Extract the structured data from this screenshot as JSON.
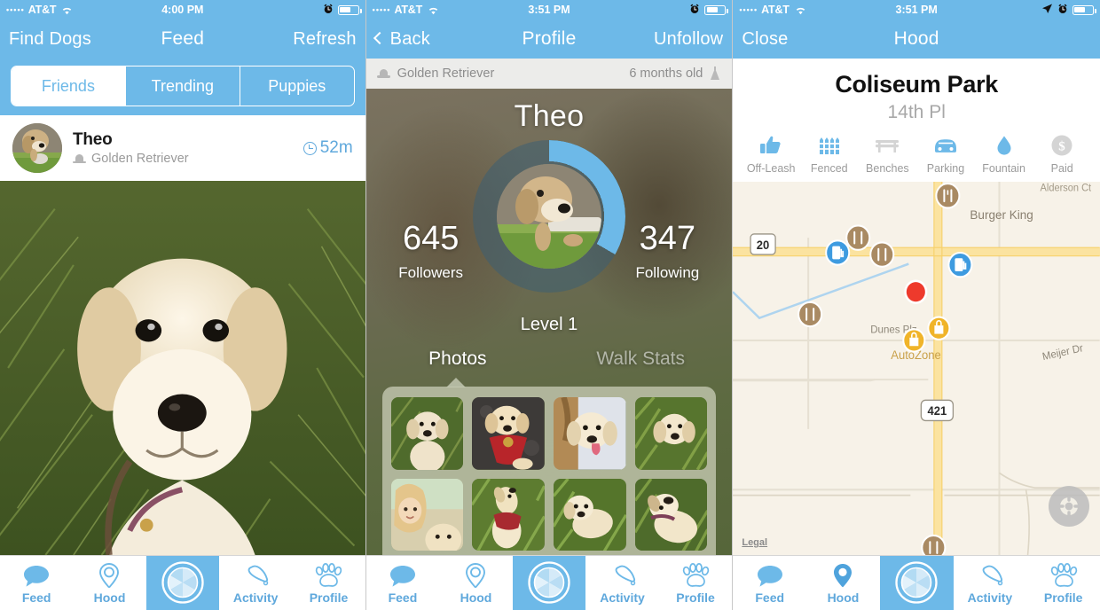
{
  "theme": {
    "accent": "#6DB9E8",
    "accent_text": "#5FA8DC",
    "inactive_gray": "#b9b9b9",
    "map_bg": "#F7F2E8"
  },
  "screens": [
    {
      "id": "feed",
      "status_bar": {
        "dots": "•••••",
        "carrier": "AT&T",
        "time": "4:00 PM",
        "icons": [
          "alarm-clock",
          "battery"
        ]
      },
      "nav": {
        "left": "Find Dogs",
        "title": "Feed",
        "right": "Refresh"
      },
      "segmented": {
        "options": [
          "Friends",
          "Trending",
          "Puppies"
        ],
        "selected": "Friends"
      },
      "feed_item": {
        "name": "Theo",
        "breed": "Golden Retriever",
        "time": "52m",
        "photo_alt": "golden-retriever-puppy-in-grass"
      }
    },
    {
      "id": "profile",
      "status_bar": {
        "dots": "•••••",
        "carrier": "AT&T",
        "time": "3:51 PM",
        "icons": [
          "alarm-clock",
          "battery"
        ]
      },
      "nav": {
        "left": "Back",
        "title": "Profile",
        "right": "Unfollow"
      },
      "breed_bar": {
        "breed": "Golden Retriever",
        "age": "6 months old"
      },
      "profile": {
        "name": "Theo",
        "followers_count": "645",
        "followers_label": "Followers",
        "following_count": "347",
        "following_label": "Following",
        "level": "Level 1",
        "ring_percent": 33
      },
      "tabs": {
        "options": [
          "Photos",
          "Walk Stats"
        ],
        "selected": "Photos"
      },
      "photo_grid": [
        "puppy-sitting-in-grass",
        "puppy-with-red-bandana",
        "puppy-held-by-person",
        "puppy-in-tall-grass",
        "girl-selfie-with-puppy",
        "puppy-looking-up-red-collar",
        "puppy-lying-in-grass",
        "puppy-rolling-in-grass"
      ]
    },
    {
      "id": "hood",
      "status_bar": {
        "dots": "•••••",
        "carrier": "AT&T",
        "time": "3:51 PM",
        "icons": [
          "location-arrow",
          "alarm-clock",
          "battery"
        ]
      },
      "nav": {
        "left": "Close",
        "title": "Hood",
        "right": ""
      },
      "park": {
        "title": "Coliseum Park",
        "subtitle": "14th Pl"
      },
      "amenities": [
        {
          "label": "Off-Leash",
          "icon": "thumbs-up-icon",
          "active": true
        },
        {
          "label": "Fenced",
          "icon": "fence-icon",
          "active": true
        },
        {
          "label": "Benches",
          "icon": "bench-icon",
          "active": false
        },
        {
          "label": "Parking",
          "icon": "car-icon",
          "active": true
        },
        {
          "label": "Fountain",
          "icon": "water-drop-icon",
          "active": true
        },
        {
          "label": "Paid",
          "icon": "dollar-icon",
          "active": false
        }
      ],
      "map": {
        "legal": "Legal",
        "street_labels": [
          "Alderson Ct",
          "Dunes Plz",
          "Meijer Dr"
        ],
        "place_labels": [
          "Burger King",
          "AutoZone"
        ],
        "highway_shields": [
          "20",
          "421"
        ],
        "pois": [
          "restaurant",
          "restaurant",
          "restaurant",
          "restaurant",
          "gas-station",
          "gas-station",
          "shop",
          "shop"
        ],
        "selected_pin": "park-location"
      }
    }
  ],
  "tabbar": {
    "items": [
      {
        "label": "Feed",
        "icon": "speech-bubble-icon",
        "active": false
      },
      {
        "label": "Hood",
        "icon": "map-pin-icon",
        "active": false
      },
      {
        "label": "",
        "icon": "camera-shutter-icon",
        "active": true
      },
      {
        "label": "Activity",
        "icon": "bell-icon",
        "active": false
      },
      {
        "label": "Profile",
        "icon": "paw-print-icon",
        "active": false
      }
    ]
  }
}
